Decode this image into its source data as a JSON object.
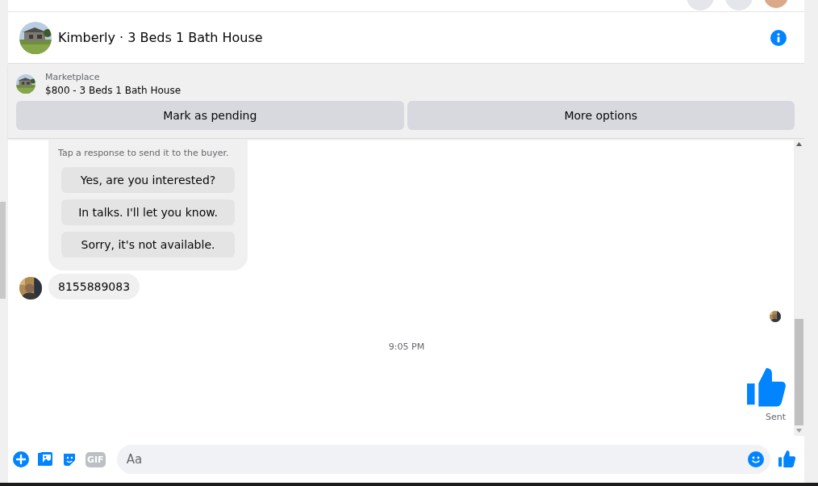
{
  "header": {
    "title": "Kimberly · 3 Beds 1 Bath House"
  },
  "listing": {
    "source": "Marketplace",
    "title": "$800 - 3 Beds 1 Bath House",
    "actions": [
      "Mark as pending",
      "More options"
    ]
  },
  "quick_response": {
    "hint": "Tap a response to send it to the buyer.",
    "options": [
      "Yes, are you interested?",
      "In talks. I'll let you know.",
      "Sorry, it's not available."
    ]
  },
  "messages": [
    {
      "kind": "incoming",
      "text": "8155889083"
    },
    {
      "kind": "read-receipt"
    },
    {
      "kind": "timestamp",
      "text": "9:05 PM"
    },
    {
      "kind": "like",
      "status": "Sent"
    }
  ],
  "composer": {
    "gif_label": "GIF",
    "placeholder": "Aa"
  }
}
